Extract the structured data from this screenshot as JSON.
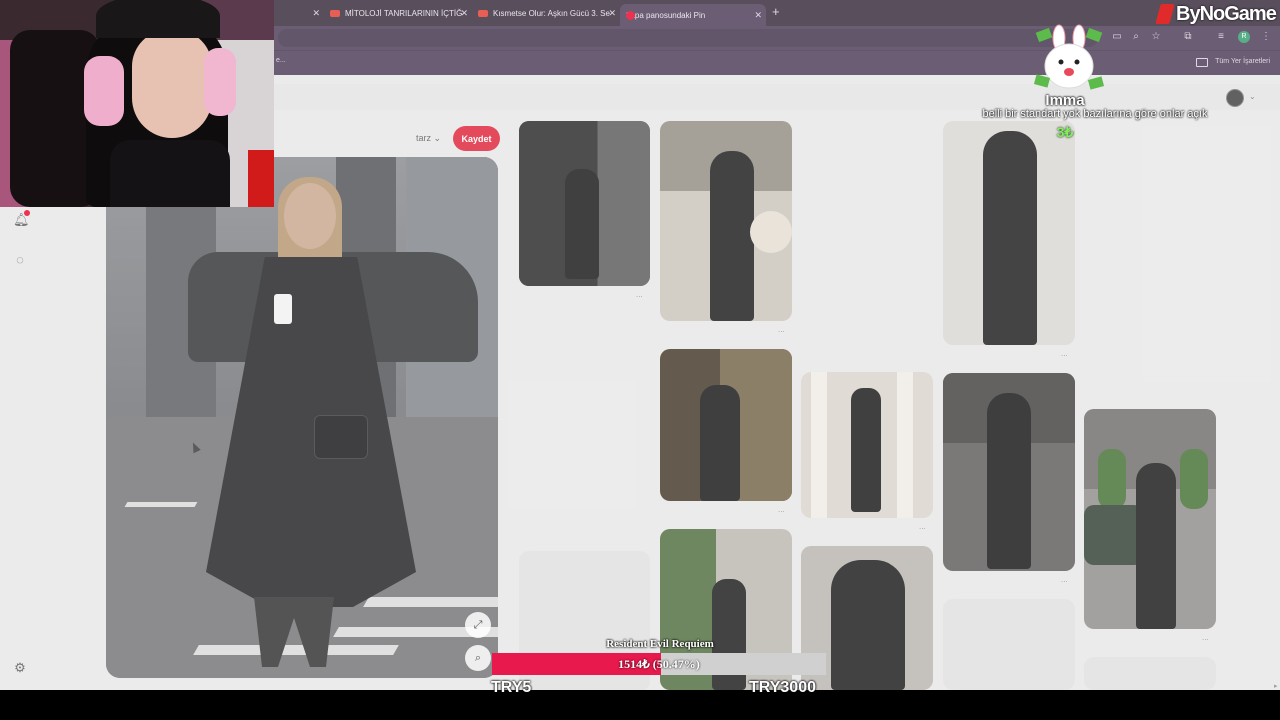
{
  "browser": {
    "tabs": [
      {
        "title": "",
        "type": "blank"
      },
      {
        "title": "MİTOLOJİ TANRILARININ İÇTİĞ",
        "type": "youtube"
      },
      {
        "title": "Kısmetse Olur: Aşkın Gücü 3. Se",
        "type": "youtube"
      },
      {
        "title": "3apa panosundaki Pin",
        "type": "pinterest",
        "active": true
      }
    ],
    "new_tab_label": "+",
    "close_label": "✕",
    "bookmarks": {
      "all_bookmarks_label": "Tüm Yer İşaretleri",
      "left_fragment": "e..."
    }
  },
  "pin_page": {
    "board_selector": "tarz",
    "save_button": "Kaydet",
    "expand_icon": "expand-icon",
    "visual_search_icon": "visual-search-icon",
    "more_label": "...",
    "sidebar_icons": [
      "bell-icon",
      "chat-icon",
      "settings-icon"
    ]
  },
  "stream_overlay": {
    "brand": "ByNoGame",
    "donation": {
      "name": "Imma",
      "message": "belli bir standart yok bazılarına göre onlar açık",
      "amount": "3₺"
    },
    "goal": {
      "title": "Resident Evil Requiem",
      "progress_text": "1514₺ (50.47%)",
      "progress_fraction": 0.5047,
      "min_label": "TRY5",
      "max_label": "TRY3000"
    }
  },
  "colors": {
    "chrome_dark": "#2f2234",
    "chrome_mid": "#463550",
    "pinterest_red": "#dd1f34",
    "goal_fill": "#e8194c",
    "donation_amount": "#7ef05a"
  }
}
